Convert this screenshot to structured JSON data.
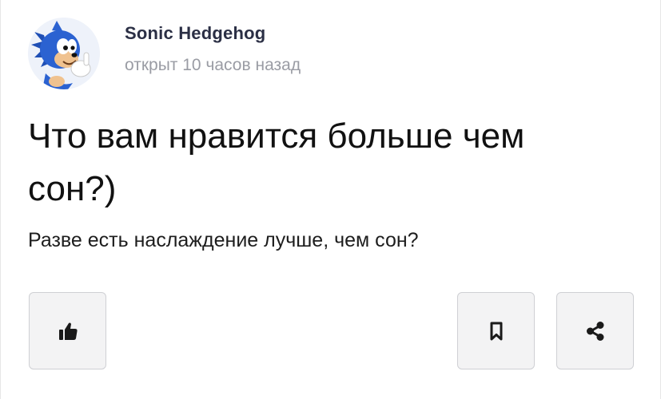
{
  "post": {
    "author": {
      "name": "Sonic Hedgehog",
      "time_ago": "открыт 10 часов назад",
      "avatar_icon": "sonic-avatar"
    },
    "title": "Что вам нравится больше чем сон?)",
    "body": "Разве есть наслаждение лучше, чем сон?"
  },
  "actions": {
    "like_icon": "thumbs-up-icon",
    "bookmark_icon": "bookmark-icon",
    "share_icon": "share-icon"
  },
  "colors": {
    "author_name": "#2b2f45",
    "meta_text": "#9a9ca4",
    "button_bg": "#f3f3f4",
    "button_border": "#cfd0d4",
    "icon": "#1a1a1a"
  }
}
